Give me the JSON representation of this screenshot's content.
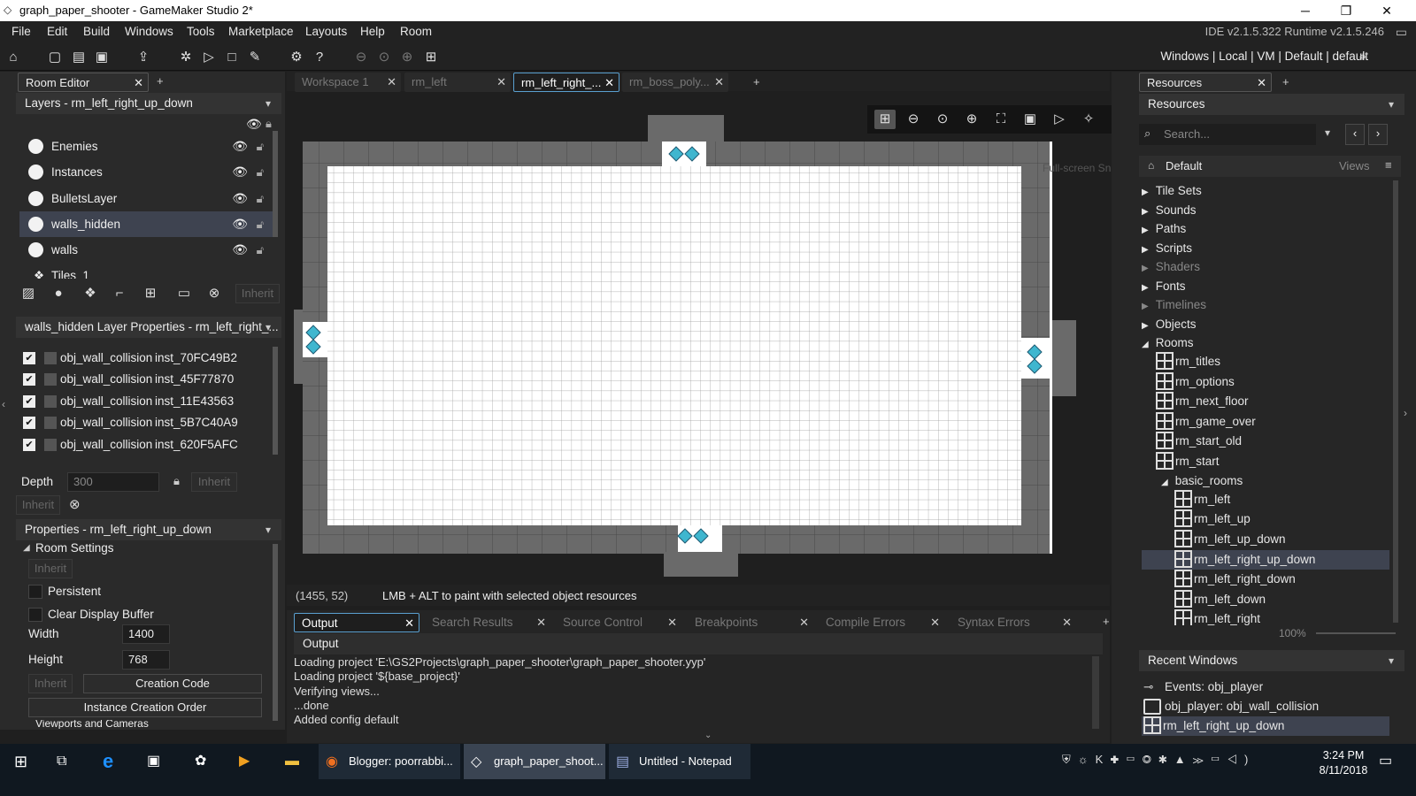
{
  "window": {
    "title": "graph_paper_shooter - GameMaker Studio 2*"
  },
  "menu": [
    "File",
    "Edit",
    "Build",
    "Windows",
    "Tools",
    "Marketplace",
    "Layouts",
    "Help",
    "Room"
  ],
  "ide_version": "IDE v2.1.5.322 Runtime v2.1.5.246",
  "target": "Windows | Local | VM | Default | default",
  "left_tab": "Room Editor",
  "layers_header": "Layers - rm_left_right_up_down",
  "layers": [
    "Enemies",
    "Instances",
    "BulletsLayer",
    "walls_hidden",
    "walls",
    "Tiles_1"
  ],
  "inherit": "Inherit",
  "layer_props_header": "walls_hidden Layer Properties - rm_left_right_...",
  "instances": [
    {
      "obj": "obj_wall_collision",
      "id": "inst_70FC49B2"
    },
    {
      "obj": "obj_wall_collision",
      "id": "inst_45F77870"
    },
    {
      "obj": "obj_wall_collision",
      "id": "inst_11E43563"
    },
    {
      "obj": "obj_wall_collision",
      "id": "inst_5B7C40A9"
    },
    {
      "obj": "obj_wall_collision",
      "id": "inst_620F5AFC"
    }
  ],
  "depth": {
    "label": "Depth",
    "value": "300"
  },
  "props_header": "Properties - rm_left_right_up_down",
  "room_settings": {
    "label": "Room Settings",
    "persistent": "Persistent",
    "clear": "Clear Display Buffer",
    "width_label": "Width",
    "width": "1400",
    "height_label": "Height",
    "height": "768",
    "creation_code": "Creation Code",
    "instance_order": "Instance Creation Order",
    "viewports": "Viewports and Cameras"
  },
  "doc_tabs": [
    "Workspace 1",
    "rm_left",
    "rm_left_right_...",
    "rm_boss_poly..."
  ],
  "status": {
    "coords": "(1455, 52)",
    "hint": "LMB + ALT to paint with selected object resources"
  },
  "overlay_text": "Full-screen Snip",
  "output_tabs": [
    "Output",
    "Search Results",
    "Source Control",
    "Breakpoints",
    "Compile Errors",
    "Syntax Errors"
  ],
  "output_header": "Output",
  "output_lines": [
    "Loading project 'E:\\GS2Projects\\graph_paper_shooter\\graph_paper_shooter.yyp'",
    "Loading project '${base_project}'",
    "Verifying views...",
    "...done",
    "Added config default"
  ],
  "resources": {
    "tab": "Resources",
    "header": "Resources",
    "search_placeholder": "Search...",
    "default": "Default",
    "views": "Views",
    "groups": [
      "Tile Sets",
      "Sounds",
      "Paths",
      "Scripts",
      "Shaders",
      "Fonts",
      "Timelines",
      "Objects",
      "Rooms"
    ],
    "rooms": [
      "rm_titles",
      "rm_options",
      "rm_next_floor",
      "rm_game_over",
      "rm_start_old",
      "rm_start"
    ],
    "basic_rooms": "basic_rooms",
    "basic": [
      "rm_left",
      "rm_left_up",
      "rm_left_up_down",
      "rm_left_right_up_down",
      "rm_left_right_down",
      "rm_left_down",
      "rm_left_right"
    ],
    "zoom": "100%"
  },
  "recent": {
    "header": "Recent Windows",
    "items": [
      "Events: obj_player",
      "obj_player: obj_wall_collision",
      "rm_left_right_up_down"
    ]
  },
  "taskbar": {
    "items": [
      "Blogger: poorrabbi...",
      "graph_paper_shoot...",
      "Untitled - Notepad"
    ],
    "time": "3:24 PM",
    "date": "8/11/2018"
  }
}
